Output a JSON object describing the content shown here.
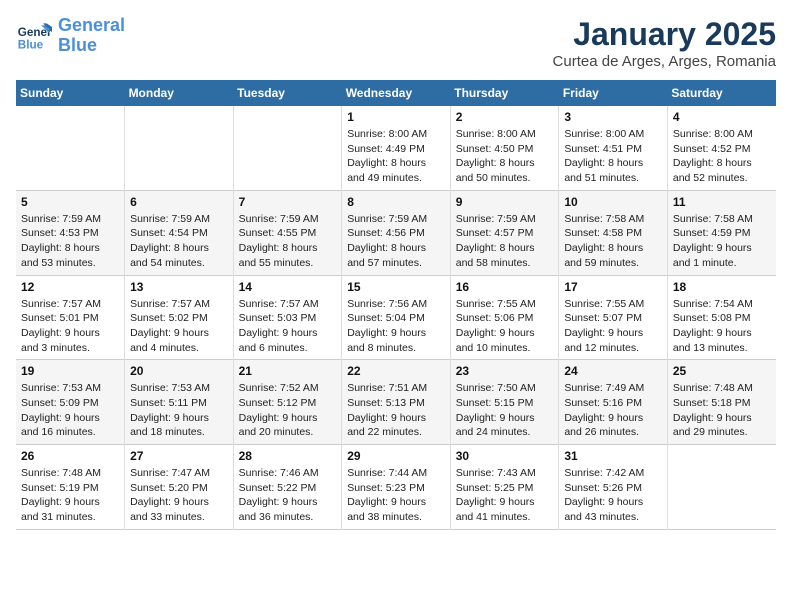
{
  "logo": {
    "line1": "General",
    "line2": "Blue"
  },
  "title": "January 2025",
  "subtitle": "Curtea de Arges, Arges, Romania",
  "days_of_week": [
    "Sunday",
    "Monday",
    "Tuesday",
    "Wednesday",
    "Thursday",
    "Friday",
    "Saturday"
  ],
  "weeks": [
    [
      {
        "day": "",
        "info": ""
      },
      {
        "day": "",
        "info": ""
      },
      {
        "day": "",
        "info": ""
      },
      {
        "day": "1",
        "info": "Sunrise: 8:00 AM\nSunset: 4:49 PM\nDaylight: 8 hours and 49 minutes."
      },
      {
        "day": "2",
        "info": "Sunrise: 8:00 AM\nSunset: 4:50 PM\nDaylight: 8 hours and 50 minutes."
      },
      {
        "day": "3",
        "info": "Sunrise: 8:00 AM\nSunset: 4:51 PM\nDaylight: 8 hours and 51 minutes."
      },
      {
        "day": "4",
        "info": "Sunrise: 8:00 AM\nSunset: 4:52 PM\nDaylight: 8 hours and 52 minutes."
      }
    ],
    [
      {
        "day": "5",
        "info": "Sunrise: 7:59 AM\nSunset: 4:53 PM\nDaylight: 8 hours and 53 minutes."
      },
      {
        "day": "6",
        "info": "Sunrise: 7:59 AM\nSunset: 4:54 PM\nDaylight: 8 hours and 54 minutes."
      },
      {
        "day": "7",
        "info": "Sunrise: 7:59 AM\nSunset: 4:55 PM\nDaylight: 8 hours and 55 minutes."
      },
      {
        "day": "8",
        "info": "Sunrise: 7:59 AM\nSunset: 4:56 PM\nDaylight: 8 hours and 57 minutes."
      },
      {
        "day": "9",
        "info": "Sunrise: 7:59 AM\nSunset: 4:57 PM\nDaylight: 8 hours and 58 minutes."
      },
      {
        "day": "10",
        "info": "Sunrise: 7:58 AM\nSunset: 4:58 PM\nDaylight: 8 hours and 59 minutes."
      },
      {
        "day": "11",
        "info": "Sunrise: 7:58 AM\nSunset: 4:59 PM\nDaylight: 9 hours and 1 minute."
      }
    ],
    [
      {
        "day": "12",
        "info": "Sunrise: 7:57 AM\nSunset: 5:01 PM\nDaylight: 9 hours and 3 minutes."
      },
      {
        "day": "13",
        "info": "Sunrise: 7:57 AM\nSunset: 5:02 PM\nDaylight: 9 hours and 4 minutes."
      },
      {
        "day": "14",
        "info": "Sunrise: 7:57 AM\nSunset: 5:03 PM\nDaylight: 9 hours and 6 minutes."
      },
      {
        "day": "15",
        "info": "Sunrise: 7:56 AM\nSunset: 5:04 PM\nDaylight: 9 hours and 8 minutes."
      },
      {
        "day": "16",
        "info": "Sunrise: 7:55 AM\nSunset: 5:06 PM\nDaylight: 9 hours and 10 minutes."
      },
      {
        "day": "17",
        "info": "Sunrise: 7:55 AM\nSunset: 5:07 PM\nDaylight: 9 hours and 12 minutes."
      },
      {
        "day": "18",
        "info": "Sunrise: 7:54 AM\nSunset: 5:08 PM\nDaylight: 9 hours and 13 minutes."
      }
    ],
    [
      {
        "day": "19",
        "info": "Sunrise: 7:53 AM\nSunset: 5:09 PM\nDaylight: 9 hours and 16 minutes."
      },
      {
        "day": "20",
        "info": "Sunrise: 7:53 AM\nSunset: 5:11 PM\nDaylight: 9 hours and 18 minutes."
      },
      {
        "day": "21",
        "info": "Sunrise: 7:52 AM\nSunset: 5:12 PM\nDaylight: 9 hours and 20 minutes."
      },
      {
        "day": "22",
        "info": "Sunrise: 7:51 AM\nSunset: 5:13 PM\nDaylight: 9 hours and 22 minutes."
      },
      {
        "day": "23",
        "info": "Sunrise: 7:50 AM\nSunset: 5:15 PM\nDaylight: 9 hours and 24 minutes."
      },
      {
        "day": "24",
        "info": "Sunrise: 7:49 AM\nSunset: 5:16 PM\nDaylight: 9 hours and 26 minutes."
      },
      {
        "day": "25",
        "info": "Sunrise: 7:48 AM\nSunset: 5:18 PM\nDaylight: 9 hours and 29 minutes."
      }
    ],
    [
      {
        "day": "26",
        "info": "Sunrise: 7:48 AM\nSunset: 5:19 PM\nDaylight: 9 hours and 31 minutes."
      },
      {
        "day": "27",
        "info": "Sunrise: 7:47 AM\nSunset: 5:20 PM\nDaylight: 9 hours and 33 minutes."
      },
      {
        "day": "28",
        "info": "Sunrise: 7:46 AM\nSunset: 5:22 PM\nDaylight: 9 hours and 36 minutes."
      },
      {
        "day": "29",
        "info": "Sunrise: 7:44 AM\nSunset: 5:23 PM\nDaylight: 9 hours and 38 minutes."
      },
      {
        "day": "30",
        "info": "Sunrise: 7:43 AM\nSunset: 5:25 PM\nDaylight: 9 hours and 41 minutes."
      },
      {
        "day": "31",
        "info": "Sunrise: 7:42 AM\nSunset: 5:26 PM\nDaylight: 9 hours and 43 minutes."
      },
      {
        "day": "",
        "info": ""
      }
    ]
  ]
}
